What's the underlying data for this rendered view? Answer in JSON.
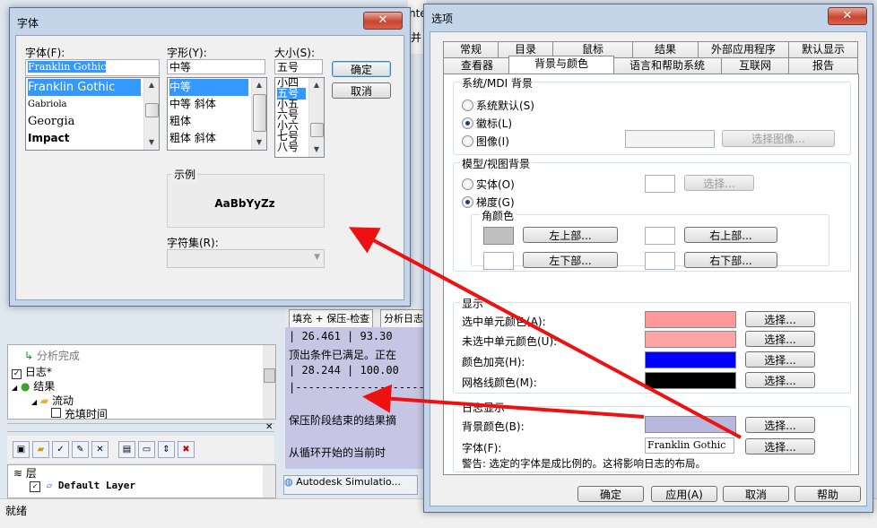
{
  "background": {
    "status_text": "就绪",
    "tree_items": [
      "分析完成",
      "日志*",
      "结果",
      "流动",
      "充填时间"
    ],
    "layer_item": "Default Layer",
    "layer_group_label": "层",
    "log_tabs": [
      "填充 + 保压-检查",
      "分析日志"
    ],
    "log_lines": [
      "|   26.461  |    93.30",
      "顶出条件已满足。正在",
      "|   28.244  |   100.00",
      "|-----------------------",
      "保压阶段结束的结果摘",
      "    从循环开始的当前时"
    ],
    "taskbar_label": "Autodesk Simulatio...",
    "bg_title_fragment": "nte",
    "bg_title_char": "并"
  },
  "font_dialog": {
    "title": "字体",
    "close_glyph": "✕",
    "font_label": "字体(F):",
    "font_value": "Franklin Gothic",
    "font_list": [
      "Franklin Gothic",
      "Gabriola",
      "Georgia",
      "Impact"
    ],
    "style_label": "字形(Y):",
    "style_value": "中等",
    "style_list": [
      "中等",
      "中等 斜体",
      "粗体",
      "粗体 斜体"
    ],
    "size_label": "大小(S):",
    "size_value": "五号",
    "size_list": [
      "小四",
      "五号",
      "小五",
      "六号",
      "小六",
      "七号",
      "八号"
    ],
    "ok_label": "确定",
    "cancel_label": "取消",
    "sample_title": "示例",
    "sample_text": "AaBbYyZz",
    "charset_label": "字符集(R):"
  },
  "options_dialog": {
    "title": "选项",
    "close_glyph": "✕",
    "tabs_row1": [
      "常规",
      "目录",
      "鼠标",
      "结果",
      "外部应用程序",
      "默认显示"
    ],
    "tabs_row2": [
      "查看器",
      "背景与颜色",
      "语言和帮助系统",
      "互联网",
      "报告"
    ],
    "sys_bg_group": "系统/MDI 背景",
    "radio_system_default": "系统默认(S)",
    "radio_logo": "徽标(L)",
    "radio_image": "图像(I)",
    "select_image_button": "选择图像...",
    "model_bg_group": "模型/视图背景",
    "radio_solid": "实体(O)",
    "radio_gradient": "梯度(G)",
    "select_button_disabled": "选择...",
    "corner_color_group": "角颜色",
    "top_left_button": "左上部...",
    "top_right_button": "右上部...",
    "bottom_left_button": "左下部...",
    "bottom_right_button": "右下部...",
    "display_group": "显示",
    "selected_cell_color": "选中单元颜色(A):",
    "unselected_cell_color": "未选中单元颜色(U):",
    "highlight_color": "颜色加亮(H):",
    "grid_line_color": "网格线颜色(M):",
    "log_display_group": "日志显示",
    "log_bg_color": "背景颜色(B):",
    "log_font": "字体(F):",
    "log_font_value": "Franklin Gothic",
    "select_label": "选择...",
    "warning": "警告: 选定的字体是成比例的。这将影响日志的布局。",
    "ok_label": "确定",
    "apply_label": "应用(A)",
    "cancel_label": "取消",
    "help_label": "帮助"
  },
  "colors": {
    "selected_cell": "#ff9999",
    "unselected_cell": "#ffa3a3",
    "highlight": "#0000ff",
    "grid_line": "#000000",
    "log_background": "#b8b8de",
    "top_left_corner": "#c0c0c0",
    "arrow": "#ee1111"
  }
}
